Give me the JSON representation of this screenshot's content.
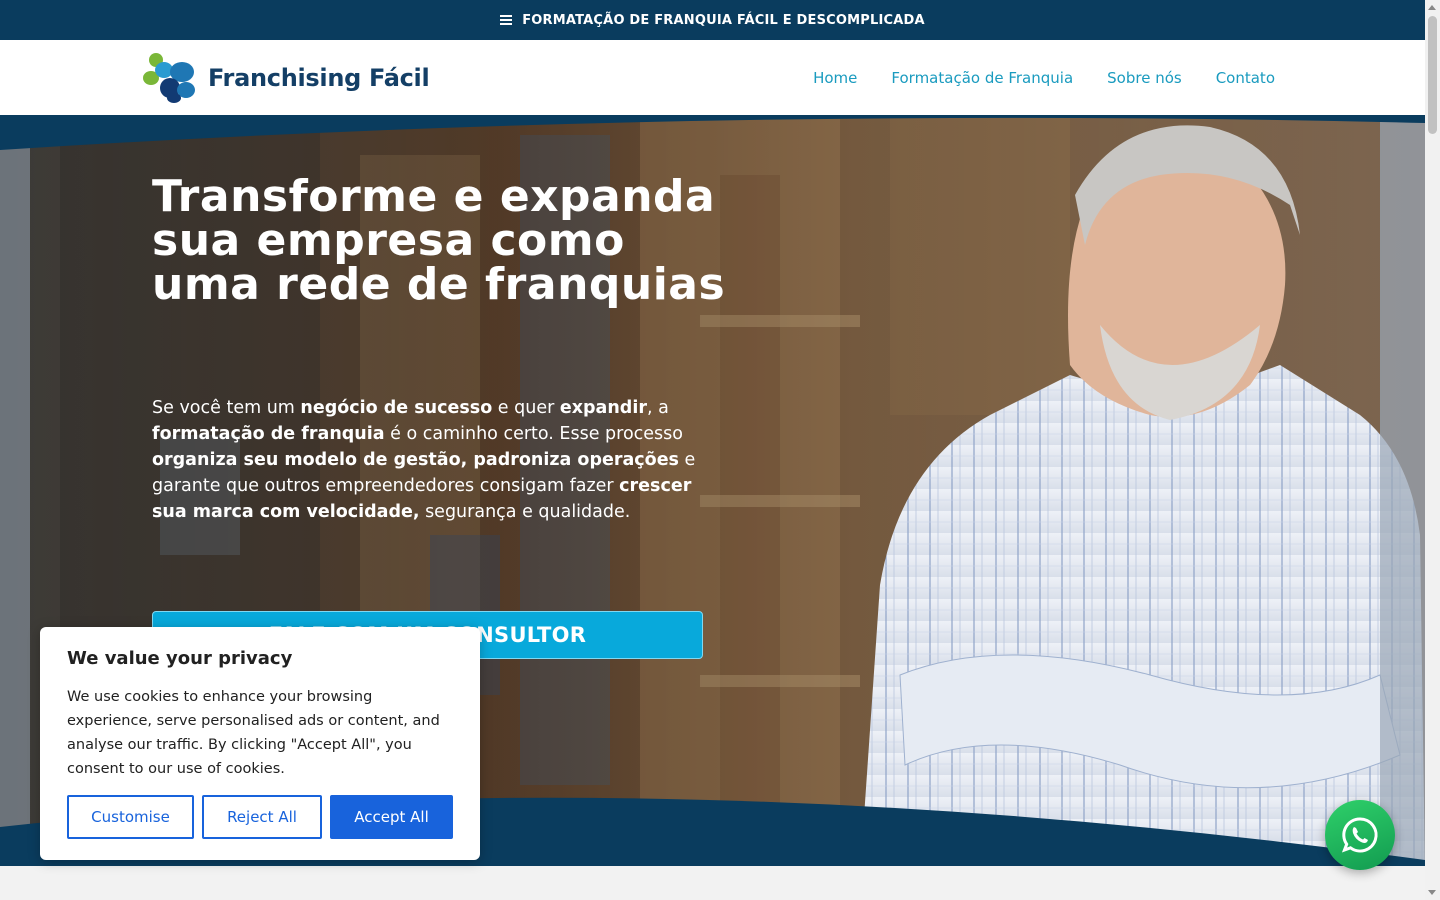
{
  "topbar": {
    "text": "FORMATAÇÃO DE FRANQUIA FÁCIL E DESCOMPLICADA"
  },
  "brand": {
    "name": "Franchising Fácil"
  },
  "nav": {
    "items": [
      {
        "label": "Home"
      },
      {
        "label": "Formatação de Franquia"
      },
      {
        "label": "Sobre nós"
      },
      {
        "label": "Contato"
      }
    ]
  },
  "hero": {
    "headline": "Transforme e expanda sua empresa como uma rede de franquias",
    "lead": [
      {
        "text": "Se você tem um ",
        "bold": false
      },
      {
        "text": "negócio de sucesso",
        "bold": true
      },
      {
        "text": " e quer ",
        "bold": false
      },
      {
        "text": "expandir",
        "bold": true
      },
      {
        "text": ", a ",
        "bold": false
      },
      {
        "text": "formatação de franquia",
        "bold": true
      },
      {
        "text": " é o caminho certo. Esse processo ",
        "bold": false
      },
      {
        "text": "organiza seu modelo de gestão, padroniza operações",
        "bold": true
      },
      {
        "text": " e garante que outros empreendedores consigam fazer ",
        "bold": false
      },
      {
        "text": "crescer sua marca com velocidade,",
        "bold": true
      },
      {
        "text": " segurança e qualidade.",
        "bold": false
      }
    ],
    "cta_label": "FALE COM UM CONSULTOR"
  },
  "cookie": {
    "title": "We value your privacy",
    "body": "We use cookies to enhance your browsing experience, serve personalised ads or content, and analyse our traffic. By clicking \"Accept All\", you consent to our use of cookies.",
    "customise_label": "Customise",
    "reject_label": "Reject All",
    "accept_label": "Accept All"
  },
  "colors": {
    "navy": "#0a3c5e",
    "accent": "#08a9db",
    "nav_link": "#1a9bbf",
    "cookie_blue": "#1863dc",
    "whatsapp_green": "#25d366"
  },
  "icons": {
    "menu": "menu-icon",
    "logo": "logo-mark-icon",
    "whatsapp": "whatsapp-icon"
  }
}
